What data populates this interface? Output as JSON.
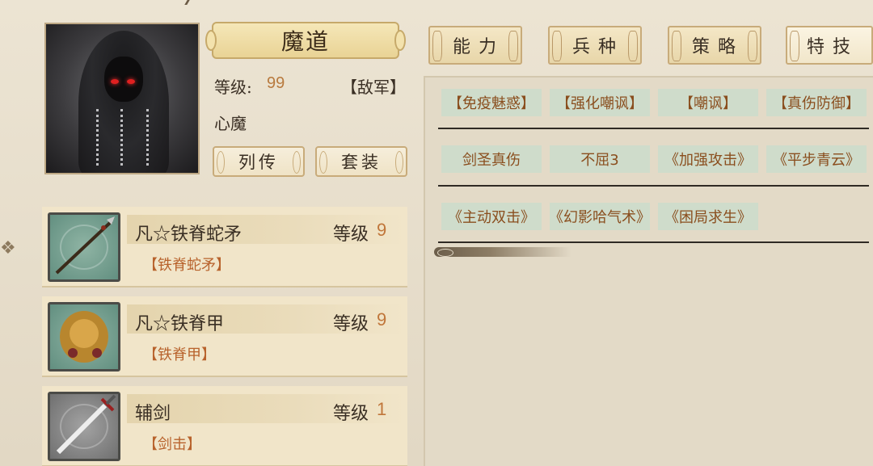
{
  "character": {
    "name": "魔道",
    "level_label": "等级:",
    "level_value": "99",
    "faction": "【敌军】",
    "title": "心魔",
    "buttons": {
      "biography": "列传",
      "set": "套装"
    }
  },
  "equipment": [
    {
      "name": "凡☆铁脊蛇矛",
      "level_label": "等级",
      "level": "9",
      "skill": "【铁脊蛇矛】",
      "icon": "spear-icon"
    },
    {
      "name": "凡☆铁脊甲",
      "level_label": "等级",
      "level": "9",
      "skill": "【铁脊甲】",
      "icon": "armor-icon"
    },
    {
      "name": "辅剑",
      "level_label": "等级",
      "level": "1",
      "skill": "【剑击】",
      "icon": "sword-icon"
    }
  ],
  "tabs": [
    {
      "label": "能力"
    },
    {
      "label": "兵种"
    },
    {
      "label": "策略"
    },
    {
      "label": "特技",
      "active": true
    }
  ],
  "skills": {
    "row1": [
      "【免疫魅惑】",
      "【强化嘲讽】",
      "【嘲讽】",
      "【真伤防御】"
    ],
    "row2": [
      "剑圣真伤",
      "不屈3",
      "《加强攻击》",
      "《平步青云》"
    ],
    "row3": [
      "《主动双击》",
      "《幻影哈气术》",
      "《困局求生》"
    ]
  },
  "colors": {
    "skill_text": "#8a4e1e",
    "skill_bg": "#cfdccb",
    "level_value": "#b87a3e"
  }
}
